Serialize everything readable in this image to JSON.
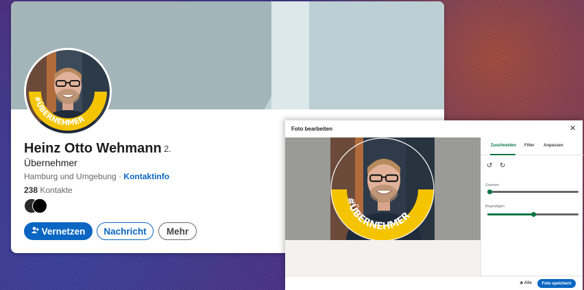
{
  "profile": {
    "name": "Heinz Otto Wehmann",
    "degree": "· 2.",
    "headline": "Übernehmer",
    "location": "Hamburg und Umgebung · ",
    "contact_link": "Kontaktinfo",
    "connections_count": "238",
    "connections_label": " Kontakte",
    "avatar_badge": "#ÜBERNEHMER",
    "buttons": {
      "connect_icon": "person-add-icon",
      "connect": "Vernetzen",
      "message": "Nachricht",
      "more": "Mehr"
    },
    "colors": {
      "accent": "#0a66c2",
      "badge_yellow": "#f5c400"
    }
  },
  "dialog": {
    "title": "Foto bearbeiten",
    "close": "✕",
    "tabs": [
      {
        "label": "Zuschneiden",
        "active": true
      },
      {
        "label": "Filter",
        "active": false
      },
      {
        "label": "Anpassen",
        "active": false
      }
    ],
    "rotate_left": "↺",
    "rotate_right": "↻",
    "sliders": [
      {
        "label": "Zoomen",
        "value": 0.0
      },
      {
        "label": "Begradigen",
        "value": 0.5
      }
    ],
    "visibility_icon": "eye-icon",
    "visibility_label": "Alle",
    "save": "Foto speichern",
    "photo_badge": "#ÜBERNEHMER",
    "colors": {
      "active_tab": "#057642"
    }
  }
}
